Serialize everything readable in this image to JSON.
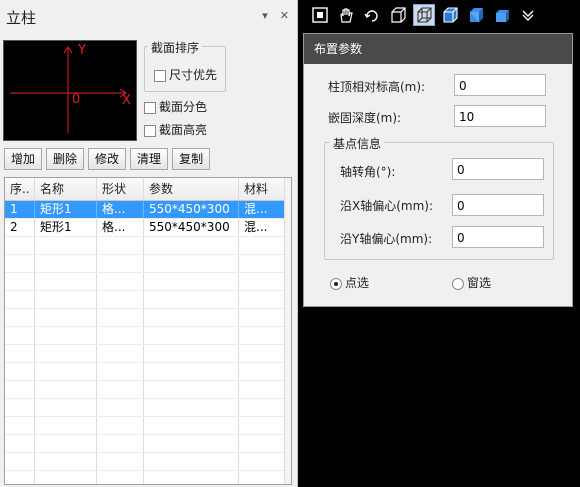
{
  "panel": {
    "title": "立柱",
    "pin_glyph": "▾",
    "close_glyph": "✕"
  },
  "preview": {
    "axis_y": "Y",
    "axis_x": "X",
    "origin": "0"
  },
  "sort_group": {
    "legend": "截面排序",
    "size_priority": "尺寸优先"
  },
  "options": {
    "section_color": "截面分色",
    "section_highlight": "截面高亮"
  },
  "buttons": {
    "add": "增加",
    "delete": "删除",
    "modify": "修改",
    "clear": "清理",
    "copy": "复制"
  },
  "table": {
    "headers": [
      "序..",
      "名称",
      "形状",
      "参数",
      "材料"
    ],
    "rows": [
      [
        "1",
        "矩形1",
        "格...",
        "550*450*300",
        "混..."
      ],
      [
        "2",
        "矩形1",
        "格...",
        "550*450*300",
        "混..."
      ]
    ],
    "selected_index": 0
  },
  "toolbar": {
    "icons": [
      "fit-view-icon",
      "pan-hand-icon",
      "rotate-view-icon",
      "wireframe-box-icon",
      "shaded-wire-box-icon",
      "solid-box-icon",
      "solid-blue-box-icon",
      "solid-blue-box-2-icon",
      "more-chevron-icon"
    ]
  },
  "dialog": {
    "title": "布置参数",
    "top_elev_label": "柱顶相对标高(m):",
    "top_elev_value": "0",
    "embed_depth_label": "嵌固深度(m):",
    "embed_depth_value": "10",
    "base_point": {
      "legend": "基点信息",
      "rotation_label": "轴转角(°):",
      "rotation_value": "0",
      "x_offset_label": "沿X轴偏心(mm):",
      "x_offset_value": "0",
      "y_offset_label": "沿Y轴偏心(mm):",
      "y_offset_value": "0"
    },
    "point_select": "点选",
    "window_select": "窗选"
  },
  "colors": {
    "selection": "#3399ff",
    "axis": "#e02020",
    "dialog_header": "#4a4a4a"
  }
}
